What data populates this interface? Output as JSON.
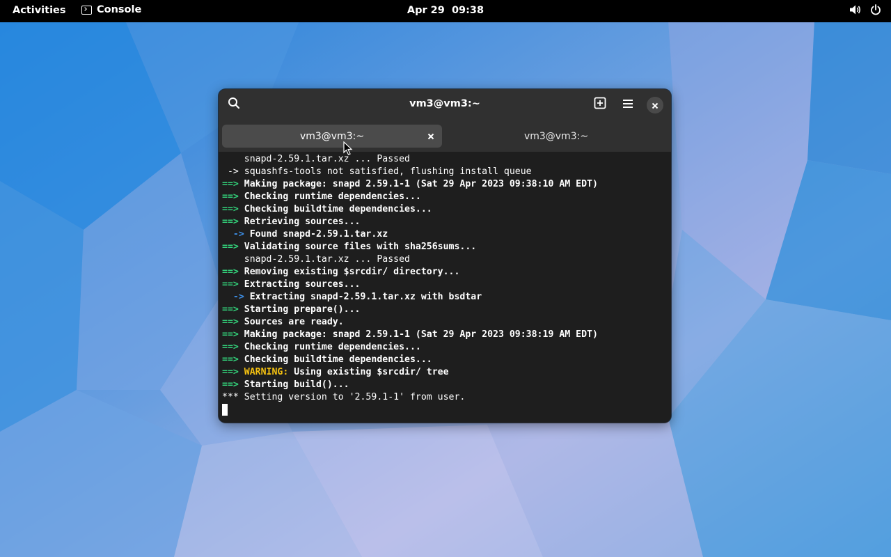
{
  "topbar": {
    "activities_label": "Activities",
    "app_name": "Console",
    "app_icon": "terminal-icon",
    "clock": "Apr 29  09:38",
    "icons": [
      "volume-icon",
      "power-icon"
    ]
  },
  "window": {
    "title": "vm3@vm3:~",
    "buttons": [
      "search-icon",
      "new-tab-icon",
      "menu-icon",
      "close-icon"
    ],
    "tabs": [
      {
        "label": "vm3@vm3:~",
        "active": true
      },
      {
        "label": "vm3@vm3:~",
        "active": false
      }
    ]
  },
  "terminal": {
    "lines": [
      {
        "prefix": "    ",
        "text": "snapd-2.59.1.tar.xz ... Passed",
        "style": "plain"
      },
      {
        "prefix": " -> ",
        "text": "squashfs-tools not satisfied, flushing install queue",
        "style": "plain"
      },
      {
        "prefix": "==> ",
        "text": "Making package: snapd 2.59.1-1 (Sat 29 Apr 2023 09:38:10 AM EDT)",
        "style": "arrow"
      },
      {
        "prefix": "==> ",
        "text": "Checking runtime dependencies...",
        "style": "arrow"
      },
      {
        "prefix": "==> ",
        "text": "Checking buildtime dependencies...",
        "style": "arrow"
      },
      {
        "prefix": "==> ",
        "text": "Retrieving sources...",
        "style": "arrow"
      },
      {
        "prefix": "  -> ",
        "text": "Found snapd-2.59.1.tar.xz",
        "style": "sub"
      },
      {
        "prefix": "==> ",
        "text": "Validating source files with sha256sums...",
        "style": "arrow"
      },
      {
        "prefix": "    ",
        "text": "snapd-2.59.1.tar.xz ... Passed",
        "style": "plain"
      },
      {
        "prefix": "==> ",
        "text": "Removing existing $srcdir/ directory...",
        "style": "arrow"
      },
      {
        "prefix": "==> ",
        "text": "Extracting sources...",
        "style": "arrow"
      },
      {
        "prefix": "  -> ",
        "text": "Extracting snapd-2.59.1.tar.xz with bsdtar",
        "style": "sub"
      },
      {
        "prefix": "==> ",
        "text": "Starting prepare()...",
        "style": "arrow"
      },
      {
        "prefix": "==> ",
        "text": "Sources are ready.",
        "style": "arrow"
      },
      {
        "prefix": "==> ",
        "text": "Making package: snapd 2.59.1-1 (Sat 29 Apr 2023 09:38:19 AM EDT)",
        "style": "arrow"
      },
      {
        "prefix": "==> ",
        "text": "Checking runtime dependencies...",
        "style": "arrow"
      },
      {
        "prefix": "==> ",
        "text": "Checking buildtime dependencies...",
        "style": "arrow"
      },
      {
        "prefix": "==> ",
        "warning": "WARNING:",
        "text": " Using existing $srcdir/ tree",
        "style": "warning"
      },
      {
        "prefix": "==> ",
        "text": "Starting build()...",
        "style": "arrow"
      },
      {
        "prefix": "*** ",
        "text": "Setting version to '2.59.1-1' from user.",
        "style": "plain"
      }
    ]
  },
  "colors": {
    "arrow": "#33d17a",
    "sub_arrow": "#3d8fe8",
    "warning": "#f5c211",
    "terminal_bg": "#1e1e1e",
    "headerbar_bg": "#303030"
  }
}
